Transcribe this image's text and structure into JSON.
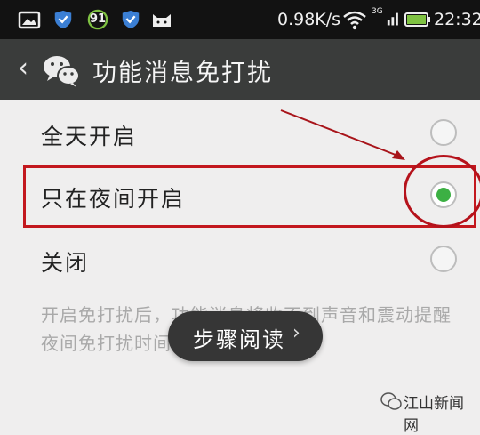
{
  "status_bar": {
    "icons": [
      "image-icon",
      "shield-icon",
      "badge-91-icon",
      "shield-icon",
      "cat-icon",
      "wifi-icon",
      "signal-3g-icon",
      "battery-icon"
    ],
    "badge_number": "91",
    "speed": "0.98K/s",
    "network_label": "3G",
    "time": "22:32"
  },
  "title_bar": {
    "back_icon": "chevron-left-icon",
    "app_icon": "wechat-icon",
    "title": "功能消息免打扰"
  },
  "options": [
    {
      "label": "全天开启",
      "selected": false
    },
    {
      "label": "只在夜间开启",
      "selected": true
    },
    {
      "label": "关闭",
      "selected": false
    }
  ],
  "hint": {
    "line1": "开启免打扰后，功能消息将收不到声音和震动提醒",
    "line2": "夜间免打扰时间"
  },
  "overlay": {
    "label": "步骤阅读",
    "arrow": "›"
  },
  "watermark": {
    "text": "江山新闻网",
    "icon": "wechat-logo-icon"
  },
  "annotation_colors": {
    "highlight": "#c3181e",
    "selected": "#3cb043"
  }
}
